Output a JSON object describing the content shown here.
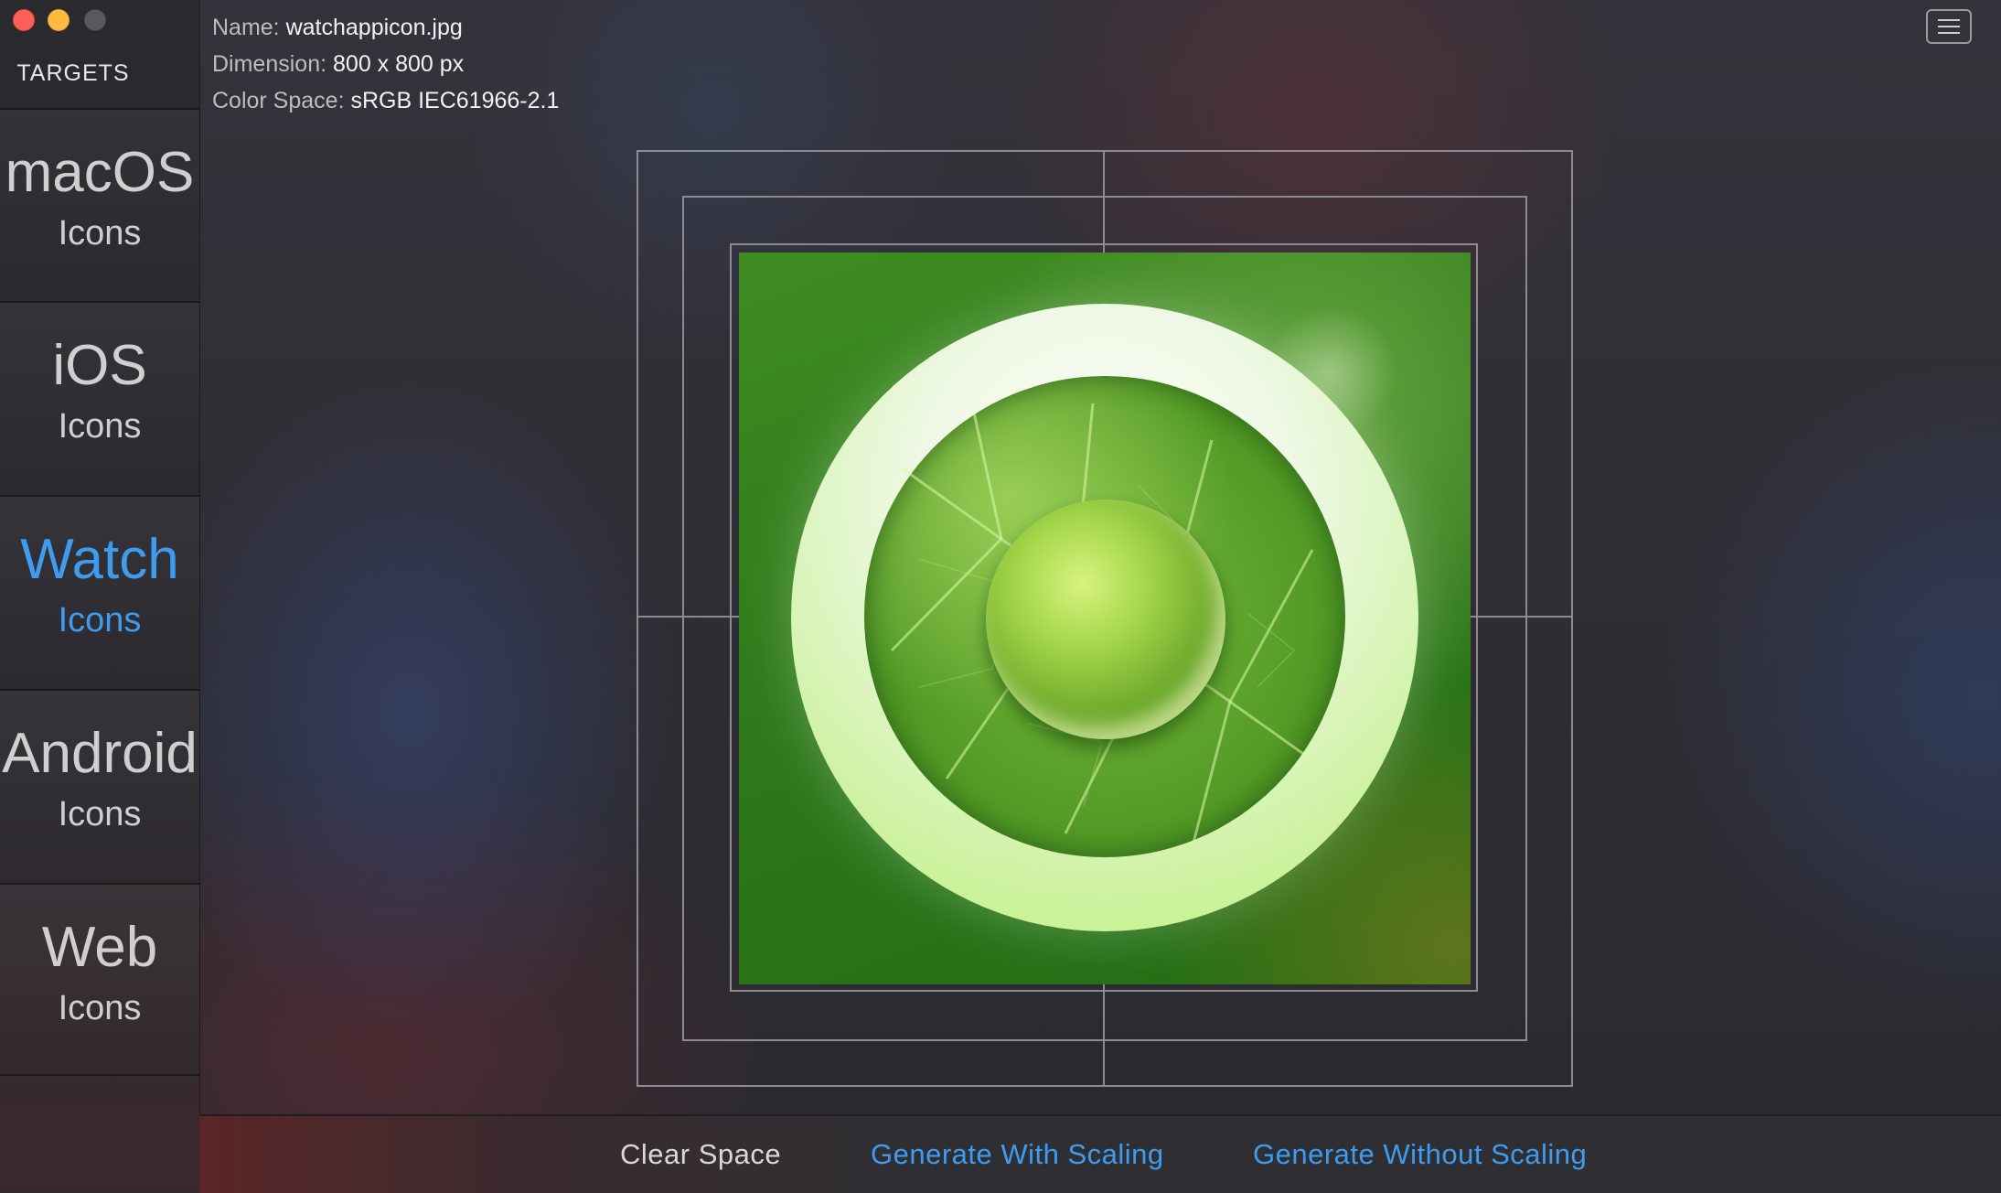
{
  "sidebar": {
    "header": "TARGETS",
    "items": [
      {
        "title": "macOS",
        "subtitle": "Icons",
        "active": false
      },
      {
        "title": "iOS",
        "subtitle": "Icons",
        "active": false
      },
      {
        "title": "Watch",
        "subtitle": "Icons",
        "active": true
      },
      {
        "title": "Android",
        "subtitle": "Icons",
        "active": false
      },
      {
        "title": "Web",
        "subtitle": "Icons",
        "active": false
      }
    ]
  },
  "info": {
    "name_label": "Name:",
    "name_value": "watchappicon.jpg",
    "dimension_label": "Dimension:",
    "dimension_value": "800 x 800 px",
    "colorspace_label": "Color Space:",
    "colorspace_value": "sRGB IEC61966-2.1"
  },
  "toolbar": {
    "menu_icon": "hamburger-menu-icon"
  },
  "preview": {
    "image": "leaf-watch-app-icon"
  },
  "actions": {
    "clear_space": "Clear Space",
    "generate_with_scaling": "Generate With Scaling",
    "generate_without_scaling": "Generate Without Scaling"
  },
  "colors": {
    "accent": "#3d9cf0",
    "close": "#fc605b",
    "minimize": "#fdbc40"
  }
}
